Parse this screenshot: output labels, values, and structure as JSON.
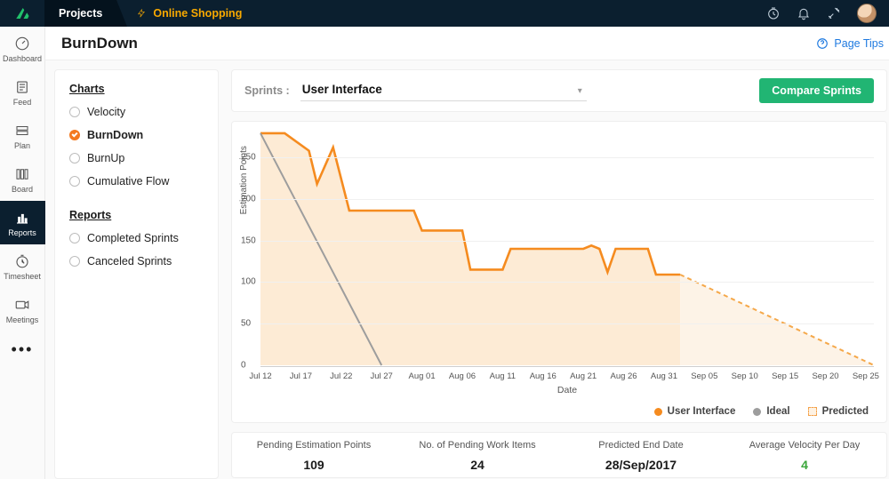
{
  "brand_accent": "#21c06b",
  "topbar": {
    "tab": "Projects",
    "project": "Online Shopping"
  },
  "rail": [
    {
      "id": "dashboard",
      "label": "Dashboard"
    },
    {
      "id": "feed",
      "label": "Feed"
    },
    {
      "id": "plan",
      "label": "Plan"
    },
    {
      "id": "board",
      "label": "Board"
    },
    {
      "id": "reports",
      "label": "Reports",
      "active": true
    },
    {
      "id": "timesheet",
      "label": "Timesheet"
    },
    {
      "id": "meetings",
      "label": "Meetings"
    }
  ],
  "page": {
    "title": "BurnDown",
    "tips": "Page Tips"
  },
  "side": {
    "charts_h": "Charts",
    "reports_h": "Reports",
    "charts": [
      "Velocity",
      "BurnDown",
      "BurnUp",
      "Cumulative Flow"
    ],
    "charts_selected": "BurnDown",
    "reports": [
      "Completed Sprints",
      "Canceled Sprints"
    ]
  },
  "toolbar": {
    "label": "Sprints :",
    "selected": "User Interface",
    "compare": "Compare Sprints"
  },
  "stats": {
    "cols": [
      {
        "h": "Pending Estimation Points",
        "v": "109"
      },
      {
        "h": "No. of Pending Work Items",
        "v": "24"
      },
      {
        "h": "Predicted End Date",
        "v": "28/Sep/2017"
      },
      {
        "h": "Average Velocity Per Day",
        "v": "4",
        "green": true
      }
    ]
  },
  "legend": {
    "actual": "User Interface",
    "ideal": "Ideal",
    "predicted": "Predicted"
  },
  "chart_data": {
    "type": "line",
    "ylabel": "Estimation Points",
    "xlabel": "Date",
    "ylim": [
      0,
      280
    ],
    "yticks": [
      0,
      50,
      100,
      150,
      200,
      250
    ],
    "xticks": [
      "Jul 12",
      "Jul 17",
      "Jul 22",
      "Jul 27",
      "Aug 01",
      "Aug 06",
      "Aug 11",
      "Aug 16",
      "Aug 21",
      "Aug 26",
      "Aug 31",
      "Sep 05",
      "Sep 10",
      "Sep 15",
      "Sep 20",
      "Sep 25"
    ],
    "x_range_days": [
      0,
      76
    ],
    "series": [
      {
        "name": "User Interface",
        "color": "#f58b1f",
        "style": "solid",
        "fill": "#fde9d0",
        "points": [
          {
            "d": 0,
            "v": 279
          },
          {
            "d": 3,
            "v": 279
          },
          {
            "d": 6,
            "v": 258
          },
          {
            "d": 7,
            "v": 218
          },
          {
            "d": 9,
            "v": 262
          },
          {
            "d": 11,
            "v": 186
          },
          {
            "d": 19,
            "v": 186
          },
          {
            "d": 20,
            "v": 162
          },
          {
            "d": 25,
            "v": 162
          },
          {
            "d": 26,
            "v": 115
          },
          {
            "d": 30,
            "v": 115
          },
          {
            "d": 31,
            "v": 140
          },
          {
            "d": 40,
            "v": 140
          },
          {
            "d": 41,
            "v": 144
          },
          {
            "d": 42,
            "v": 140
          },
          {
            "d": 43,
            "v": 112
          },
          {
            "d": 44,
            "v": 140
          },
          {
            "d": 48,
            "v": 140
          },
          {
            "d": 49,
            "v": 109
          },
          {
            "d": 52,
            "v": 109
          }
        ]
      },
      {
        "name": "Ideal",
        "color": "#9d9d9d",
        "style": "solid",
        "points": [
          {
            "d": 0,
            "v": 279
          },
          {
            "d": 15,
            "v": 0
          }
        ]
      },
      {
        "name": "Predicted",
        "color": "#f5a84a",
        "style": "dashed",
        "fill": "#fdf2e4",
        "points": [
          {
            "d": 52,
            "v": 109
          },
          {
            "d": 76,
            "v": 0
          }
        ]
      }
    ]
  }
}
